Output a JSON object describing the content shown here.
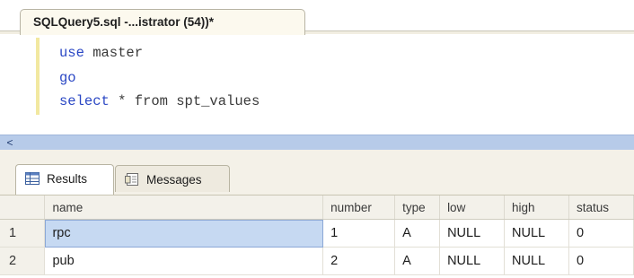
{
  "tab": {
    "title": "SQLQuery5.sql -...istrator (54))*"
  },
  "editor": {
    "lines": [
      {
        "keyword": "use",
        "rest": " master"
      },
      {
        "keyword": "go",
        "rest": ""
      },
      {
        "keyword": "select",
        "rest": " * from spt_values"
      }
    ]
  },
  "scrollbar": {
    "left_arrow": "<"
  },
  "results": {
    "tabs": [
      {
        "label": "Results",
        "icon": "grid-icon"
      },
      {
        "label": "Messages",
        "icon": "messages-icon"
      }
    ],
    "columns": [
      "name",
      "number",
      "type",
      "low",
      "high",
      "status"
    ],
    "rows": [
      {
        "num": "1",
        "cells": [
          "rpc",
          "1",
          "A",
          "NULL",
          "NULL",
          "0"
        ]
      },
      {
        "num": "2",
        "cells": [
          "pub",
          "2",
          "A",
          "NULL",
          "NULL",
          "0"
        ]
      }
    ]
  },
  "colors": {
    "keyword": "#2a47c4",
    "selection": "#c6d9f2",
    "scrollbar": "#b7cbe9"
  }
}
